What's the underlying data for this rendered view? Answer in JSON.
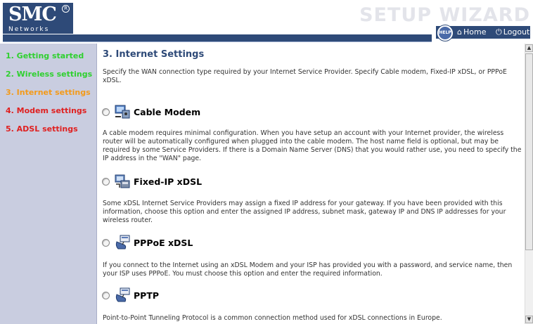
{
  "header": {
    "logo_text": "SMC",
    "logo_reg": "R",
    "logo_sub": "Networks",
    "wizard_title": "SETUP WIZARD",
    "help_label": "HELP",
    "home_label": "Home",
    "logout_label": "Logout"
  },
  "sidebar": {
    "items": [
      {
        "label": "1. Getting started",
        "color": "#2fd02f"
      },
      {
        "label": "2. Wireless settings",
        "color": "#2fd02f"
      },
      {
        "label": "3. Internet settings",
        "color": "#f39a1a"
      },
      {
        "label": "4. Modem settings",
        "color": "#e02020"
      },
      {
        "label": "5. ADSL settings",
        "color": "#e02020"
      }
    ]
  },
  "main": {
    "title": "3. Internet Settings",
    "intro": "Specify the WAN connection type required by your Internet Service Provider. Specify Cable modem, Fixed-IP xDSL, or PPPoE xDSL.",
    "options": [
      {
        "label": "Cable Modem",
        "icon": "cable-modem-icon",
        "selected": false,
        "description": "A cable modem requires minimal configuration. When you have setup an account with your Internet provider, the wireless router will be automatically configured when plugged into the cable modem. The host name field is optional, but may be required by some Service Providers. If there is a Domain Name Server (DNS) that you would rather use, you need to specify the IP address in the \"WAN\" page."
      },
      {
        "label": "Fixed-IP xDSL",
        "icon": "fixed-ip-icon",
        "selected": false,
        "description": "Some xDSL Internet Service Providers may assign a fixed IP address for your gateway. If you have been provided with this information, choose this option and enter the assigned IP address, subnet mask, gateway IP and DNS IP addresses for your wireless router."
      },
      {
        "label": "PPPoE xDSL",
        "icon": "pppoe-icon",
        "selected": false,
        "description": "If you connect to the Internet using an xDSL Modem and your ISP has provided you with a password, and service name, then your ISP uses PPPoE. You must choose this option and enter the required information."
      },
      {
        "label": "PPTP",
        "icon": "pptp-icon",
        "selected": false,
        "description": "Point-to-Point Tunneling Protocol is a common connection method used for xDSL connections in Europe."
      }
    ]
  },
  "colors": {
    "brand_blue": "#2e4a78",
    "sidebar_bg": "#c9cde0",
    "title_blue": "#2e4a78"
  }
}
